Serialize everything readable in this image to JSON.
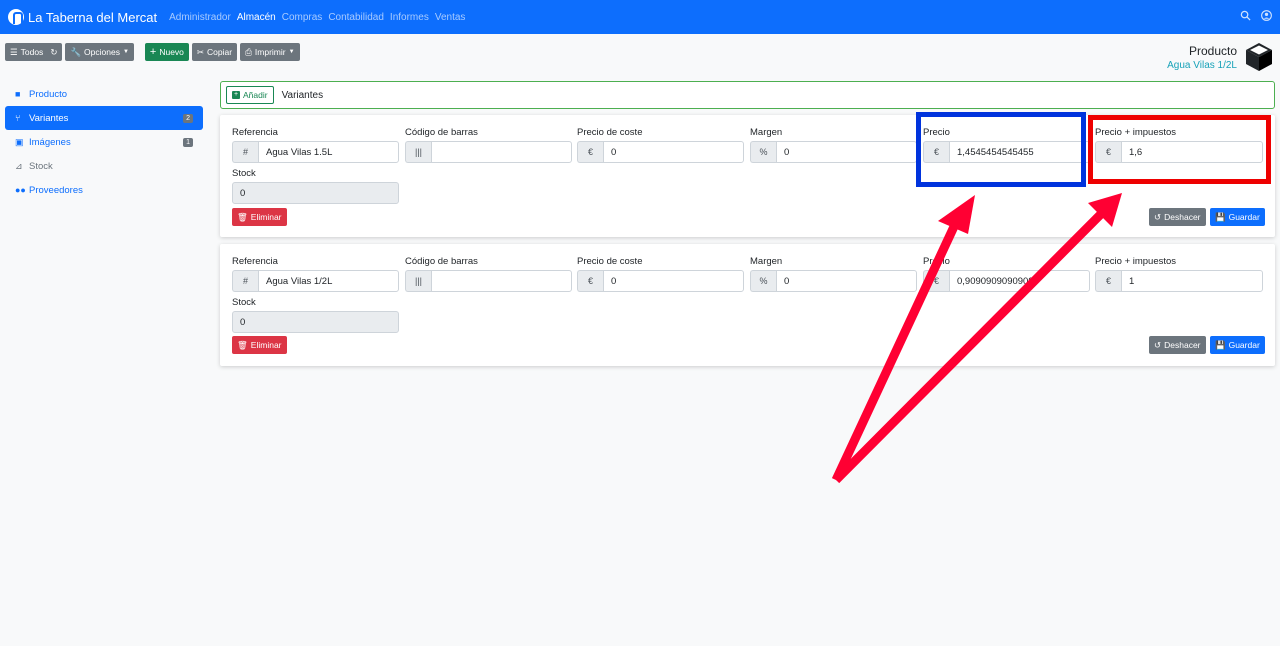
{
  "navbar": {
    "brand": "La Taberna del Mercat",
    "items": [
      "Administrador",
      "Almacén",
      "Compras",
      "Contabilidad",
      "Informes",
      "Ventas"
    ],
    "active_index": 1
  },
  "toolbar": {
    "all_label": "Todos",
    "options_label": "Opciones",
    "new_label": "Nuevo",
    "copy_label": "Copiar",
    "print_label": "Imprimir"
  },
  "product": {
    "title": "Producto",
    "subtitle": "Agua Vilas 1/2L"
  },
  "sidebar": {
    "items": [
      {
        "label": "Producto",
        "icon": "cube-icon"
      },
      {
        "label": "Variantes",
        "icon": "variants-icon",
        "badge": "2"
      },
      {
        "label": "Imágenes",
        "icon": "images-icon",
        "badge": "1"
      },
      {
        "label": "Stock",
        "icon": "dolly-icon"
      },
      {
        "label": "Proveedores",
        "icon": "users-icon"
      }
    ]
  },
  "variants_header": {
    "add_label": "Añadir",
    "title": "Variantes"
  },
  "labels": {
    "reference": "Referencia",
    "barcode": "Código de barras",
    "cost_price": "Precio de coste",
    "margin": "Margen",
    "price": "Precio",
    "price_tax": "Precio + impuestos",
    "stock": "Stock",
    "delete": "Eliminar",
    "undo": "Deshacer",
    "save": "Guardar"
  },
  "addons": {
    "hash": "#",
    "euro": "€",
    "percent": "%"
  },
  "variants": [
    {
      "reference": "Agua Vilas 1.5L",
      "barcode": "",
      "cost_price": "0",
      "margin": "0",
      "price": "1,4545454545455",
      "price_tax": "1,6",
      "stock": "0"
    },
    {
      "reference": "Agua Vilas 1/2L",
      "barcode": "",
      "cost_price": "0",
      "margin": "0",
      "price": "0,9090909090909",
      "price_tax": "1",
      "stock": "0"
    }
  ],
  "annotations": {
    "blue_box_color": "#0033dd",
    "red_box_color": "#ee0000",
    "arrow_color": "#ff0033"
  }
}
